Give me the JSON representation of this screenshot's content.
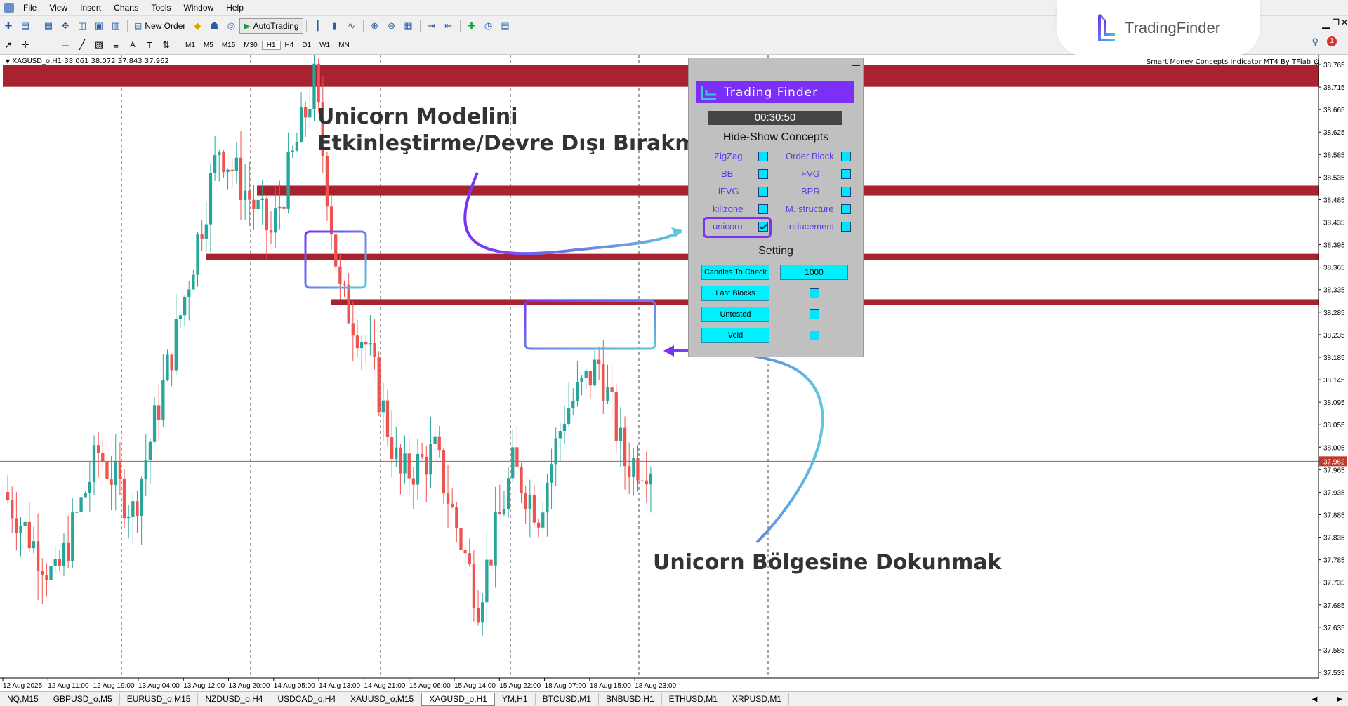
{
  "menu": {
    "items": [
      "File",
      "View",
      "Insert",
      "Charts",
      "Tools",
      "Window",
      "Help"
    ]
  },
  "toolbar": {
    "new_order_label": "New Order",
    "autotrading_label": "AutoTrading",
    "timeframes": [
      "M1",
      "M5",
      "M15",
      "M30",
      "H1",
      "H4",
      "D1",
      "W1",
      "MN"
    ],
    "active_timeframe": "H1"
  },
  "brand": {
    "name": "TradingFinder"
  },
  "chart": {
    "symbol_header": "XAGUSD_o,H1  38.061 38.072 37.843 37.962",
    "indicator_title": "Smart Money Concepts Indicator MT4 By TFlab",
    "current_price": "37.962",
    "price_ticks": [
      "38.765",
      "38.715",
      "38.665",
      "38.625",
      "38.585",
      "38.535",
      "38.485",
      "38.435",
      "38.395",
      "38.365",
      "38.335",
      "38.285",
      "38.235",
      "38.185",
      "38.145",
      "38.095",
      "38.055",
      "38.005",
      "37.965",
      "37.935",
      "37.885",
      "37.835",
      "37.785",
      "37.735",
      "37.685",
      "37.635",
      "37.585",
      "37.535"
    ],
    "time_ticks": [
      "12 Aug 2025",
      "12 Aug 11:00",
      "12 Aug 19:00",
      "13 Aug 04:00",
      "13 Aug 12:00",
      "13 Aug 20:00",
      "14 Aug 05:00",
      "14 Aug 13:00",
      "14 Aug 21:00",
      "15 Aug 06:00",
      "15 Aug 14:00",
      "15 Aug 22:00",
      "18 Aug 07:00",
      "18 Aug 15:00",
      "18 Aug 23:00"
    ],
    "colors": {
      "bull": "#26a69a",
      "bear": "#ef5350",
      "zone": "#a8232f",
      "box_gradient_start": "#7b2ff7",
      "box_gradient_end": "#5ec8d8"
    }
  },
  "annotations": {
    "top_line1": "Unicorn Modelini",
    "top_line2": "Etkinleştirme/Devre Dışı Bırakma",
    "bottom": "Unicorn Bölgesine Dokunmak"
  },
  "panel": {
    "brand": "Trading Finder",
    "timer": "00:30:50",
    "concepts_heading": "Hide-Show Concepts",
    "concepts": [
      {
        "label": "ZigZag",
        "checked": false
      },
      {
        "label": "Order Block",
        "checked": false
      },
      {
        "label": "BB",
        "checked": false
      },
      {
        "label": "FVG",
        "checked": false
      },
      {
        "label": "iFVG",
        "checked": false
      },
      {
        "label": "BPR",
        "checked": false
      },
      {
        "label": "killzone",
        "checked": false
      },
      {
        "label": "M. structure",
        "checked": false
      },
      {
        "label": "unicorn",
        "checked": true
      },
      {
        "label": "inducement",
        "checked": false
      }
    ],
    "setting_heading": "Setting",
    "candles_to_check_label": "Candles To Check",
    "candles_to_check_value": "1000",
    "last_blocks_label": "Last Blocks",
    "untested_label": "Untested",
    "void_label": "Void"
  },
  "tabs": {
    "items": [
      "NQ,M15",
      "GBPUSD_o,M5",
      "EURUSD_o,M15",
      "NZDUSD_o,H4",
      "USDCAD_o,H4",
      "XAUUSD_o,M15",
      "XAGUSD_o,H1",
      "YM,H1",
      "BTCUSD,M1",
      "BNBUSD,H1",
      "ETHUSD,M1",
      "XRPUSD,M1"
    ],
    "active": "XAGUSD_o,H1"
  }
}
